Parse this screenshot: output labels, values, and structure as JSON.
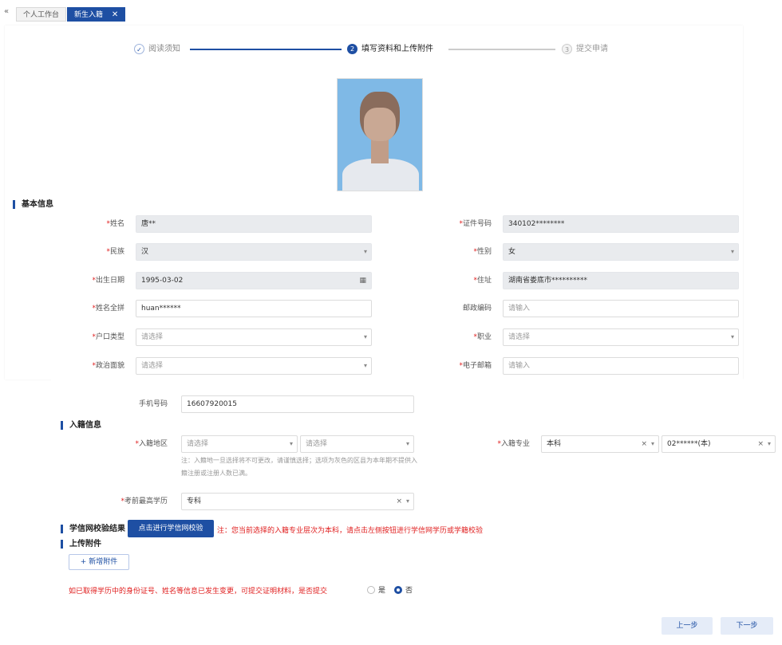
{
  "tabs": [
    {
      "label": "个人工作台"
    },
    {
      "label": "新生入籍",
      "close": "✕"
    }
  ],
  "tab_collapse": "«",
  "steps": [
    {
      "num": "✓",
      "label": "阅读须知"
    },
    {
      "num": "2",
      "label": "填写资料和上传附件"
    },
    {
      "num": "3",
      "label": "提交申请"
    }
  ],
  "sections": {
    "basic": "基本信息",
    "enroll": "入籍信息",
    "xuexin": "学信网校验结果",
    "upload": "上传附件"
  },
  "basic": {
    "name": {
      "label": "姓名",
      "value": "唐**"
    },
    "id_no": {
      "label": "证件号码",
      "value": "340102********"
    },
    "ethnic": {
      "label": "民族",
      "value": "汉"
    },
    "gender": {
      "label": "性别",
      "value": "女"
    },
    "birth": {
      "label": "出生日期",
      "value": "1995-03-02"
    },
    "address": {
      "label": "住址",
      "value": "湖南省娄底市**********"
    },
    "pinyin": {
      "label": "姓名全拼",
      "value": "huan******"
    },
    "postcode": {
      "label": "邮政编码",
      "placeholder": "请输入"
    },
    "hukou": {
      "label": "户口类型",
      "placeholder": "请选择"
    },
    "job": {
      "label": "职业",
      "placeholder": "请选择"
    },
    "politics": {
      "label": "政治面貌",
      "placeholder": "请选择"
    },
    "email": {
      "label": "电子邮箱",
      "placeholder": "请输入"
    },
    "phone": {
      "label": "手机号码",
      "value": "16607920015"
    }
  },
  "enroll": {
    "region": {
      "label": "入籍地区",
      "placeholder1": "请选择",
      "placeholder2": "请选择"
    },
    "region_note": "注：入籍地一旦选择将不可更改，请谨慎选择；选项为灰色的区县为本年期不提供入籍注册或注册人数已满。",
    "major": {
      "label": "入籍专业",
      "level": "本科",
      "name": "02******(本)"
    },
    "highest_edu": {
      "label": "考前最高学历",
      "value": "专科"
    }
  },
  "xuexin": {
    "button": "点击进行学信网校验",
    "note": "注：您当前选择的入籍专业层次为本科，请点击左侧按钮进行学信网学历或学籍校验"
  },
  "upload": {
    "button": "+ 新增附件"
  },
  "question": {
    "text": "如已取得学历中的身份证号、姓名等信息已发生变更，可提交证明材料，是否提交",
    "yes": "是",
    "no": "否"
  },
  "nav": {
    "prev": "上一步",
    "next": "下一步"
  },
  "icons": {
    "arrow": "▾",
    "clear": "×",
    "calendar": "▦"
  },
  "colors": {
    "primary": "#1e4fa3",
    "required": "#e02020"
  }
}
